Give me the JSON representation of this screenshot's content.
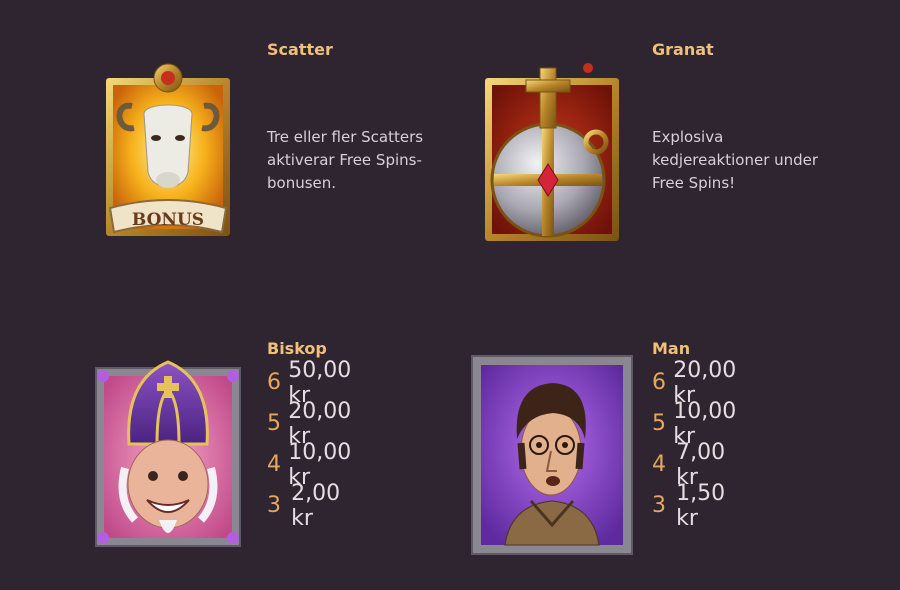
{
  "symbols": [
    {
      "name": "Scatter",
      "description": "Tre eller fler Scatters aktiverar Free Spins-bonusen.",
      "icon": "goat-bonus-icon",
      "badge": "BONUS"
    },
    {
      "name": "Granat",
      "description": "Explosiva kedjereaktioner under Free Spins!",
      "icon": "orb-grenade-icon"
    },
    {
      "name": "Biskop",
      "icon": "bishop-icon",
      "pays": [
        {
          "count": "6",
          "amount": "50,00 kr"
        },
        {
          "count": "5",
          "amount": "20,00 kr"
        },
        {
          "count": "4",
          "amount": "10,00 kr"
        },
        {
          "count": "3",
          "amount": "2,00 kr"
        }
      ]
    },
    {
      "name": "Man",
      "icon": "man-icon",
      "pays": [
        {
          "count": "6",
          "amount": "20,00 kr"
        },
        {
          "count": "5",
          "amount": "10,00 kr"
        },
        {
          "count": "4",
          "amount": "7,00 kr"
        },
        {
          "count": "3",
          "amount": "1,50 kr"
        }
      ]
    }
  ],
  "colors": {
    "background": "#2e2530",
    "title": "#f0c07a",
    "pay_count": "#e8a65a",
    "text": "#d8d0d6"
  }
}
